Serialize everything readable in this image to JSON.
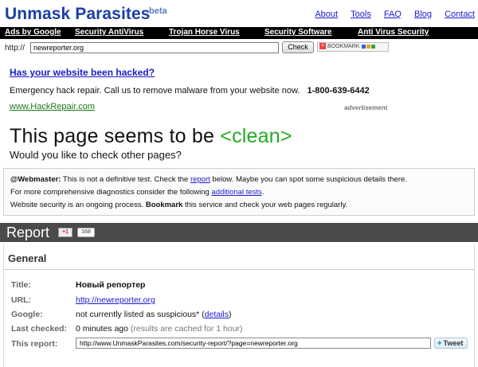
{
  "header": {
    "title": "Unmask Parasites",
    "beta": "beta",
    "nav": [
      "About",
      "Tools",
      "FAQ",
      "Blog",
      "Contact"
    ]
  },
  "adbar": {
    "ads_by": "Ads by Google",
    "links": [
      "Security AntiVirus",
      "Trojan Horse Virus",
      "Security Software",
      "Anti Virus Security"
    ]
  },
  "url_check": {
    "prefix": "http://",
    "value": "newreporter.org",
    "check_label": "Check",
    "bookmark_label": "BOOKMARK"
  },
  "ad": {
    "headline": "Has your website been hacked?",
    "text": "Emergency hack repair.   Call us to remove malware from your website now.",
    "phone": "1-800-639-6442",
    "url": "www.HackRepair.com",
    "advertisement": "advertisement"
  },
  "result": {
    "title_prefix": "This page seems to be ",
    "status": "<clean>",
    "subtitle": "Would you like to check other pages?"
  },
  "webmaster": {
    "line1_bold": "@Webmaster:",
    "line1_a": " This is not a definitive test. Check the ",
    "line1_link": "report",
    "line1_b": " below. Maybe you can spot some suspicious details there.",
    "line2_a": "For more comprehensive diagnostics consider the following ",
    "line2_link": "additional tests",
    "line2_b": ".",
    "line3_a": "Website security is an ongoing process. ",
    "line3_bold": "Bookmark",
    "line3_b": " this service and check your web pages regularly."
  },
  "report": {
    "title": "Report",
    "gplus_label": "+1",
    "gplus_count": "168",
    "section": "General",
    "rows": {
      "title_label": "Title:",
      "title_value": "Новый репортер",
      "url_label": "URL:",
      "url_value": "http://newreporter.org",
      "google_label": "Google:",
      "google_value": "not currently listed as suspicious* (",
      "google_link": "details",
      "google_end": ")",
      "checked_label": "Last checked:",
      "checked_value": "0 minutes ago",
      "checked_note": " (results are cached for 1 hour)",
      "report_label": "This report:",
      "report_url": "http://www.UnmaskParasites.com/security-report/?page=newreporter.org",
      "tweet_label": "Tweet"
    }
  }
}
